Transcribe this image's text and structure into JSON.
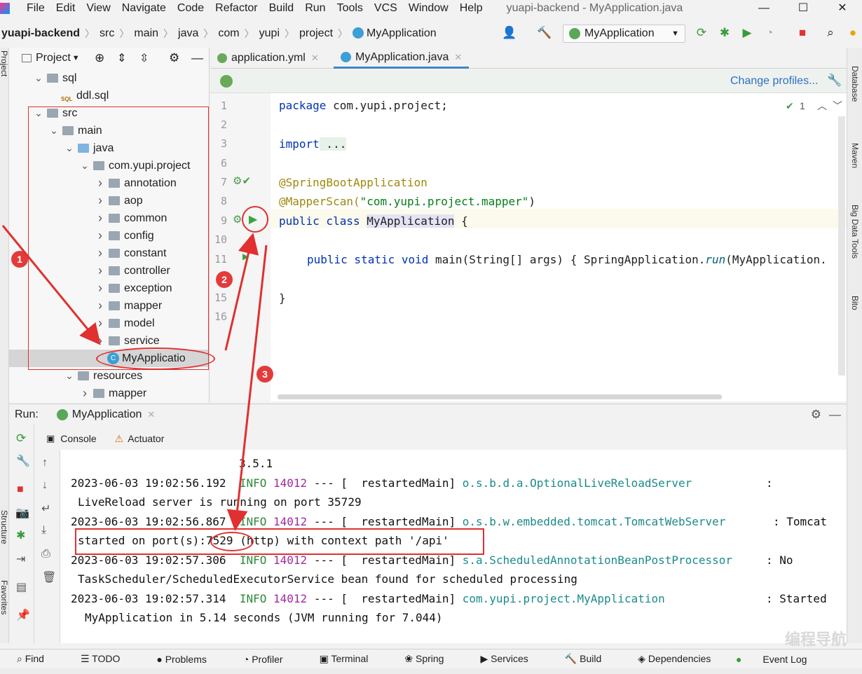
{
  "menubar": {
    "items": [
      "File",
      "Edit",
      "View",
      "Navigate",
      "Code",
      "Refactor",
      "Build",
      "Run",
      "Tools",
      "VCS",
      "Window",
      "Help"
    ],
    "window_title": "yuapi-backend - MyApplication.java",
    "win_min": "—",
    "win_max": "☐",
    "win_close": "✕"
  },
  "breadcrumb": [
    "yuapi-backend",
    "src",
    "main",
    "java",
    "com",
    "yupi",
    "project",
    "MyApplication"
  ],
  "run_config": {
    "label": "MyApplication"
  },
  "project": {
    "title": "Project",
    "tree": [
      {
        "label": "sql",
        "depth": 1,
        "kind": "folder",
        "expanded": true
      },
      {
        "label": "ddl.sql",
        "depth": 2,
        "kind": "sql"
      },
      {
        "label": "src",
        "depth": 1,
        "kind": "folder",
        "expanded": true
      },
      {
        "label": "main",
        "depth": 2,
        "kind": "folder",
        "expanded": true
      },
      {
        "label": "java",
        "depth": 3,
        "kind": "folder-blue",
        "expanded": true
      },
      {
        "label": "com.yupi.project",
        "depth": 4,
        "kind": "folder",
        "expanded": true
      },
      {
        "label": "annotation",
        "depth": 5,
        "kind": "folder",
        "expanded": false
      },
      {
        "label": "aop",
        "depth": 5,
        "kind": "folder",
        "expanded": false
      },
      {
        "label": "common",
        "depth": 5,
        "kind": "folder",
        "expanded": false
      },
      {
        "label": "config",
        "depth": 5,
        "kind": "folder",
        "expanded": false
      },
      {
        "label": "constant",
        "depth": 5,
        "kind": "folder",
        "expanded": false
      },
      {
        "label": "controller",
        "depth": 5,
        "kind": "folder",
        "expanded": false
      },
      {
        "label": "exception",
        "depth": 5,
        "kind": "folder",
        "expanded": false
      },
      {
        "label": "mapper",
        "depth": 5,
        "kind": "folder",
        "expanded": false
      },
      {
        "label": "model",
        "depth": 5,
        "kind": "folder",
        "expanded": false
      },
      {
        "label": "service",
        "depth": 5,
        "kind": "folder",
        "expanded": false
      },
      {
        "label": "MyApplicatio",
        "depth": 5,
        "kind": "class",
        "selected": true
      },
      {
        "label": "resources",
        "depth": 3,
        "kind": "folder",
        "expanded": true
      },
      {
        "label": "mapper",
        "depth": 4,
        "kind": "folder",
        "expanded": false
      }
    ]
  },
  "editor": {
    "tabs": [
      {
        "label": "application.yml",
        "active": false
      },
      {
        "label": "MyApplication.java",
        "active": true
      }
    ],
    "change_profiles": "Change profiles...",
    "inspection_count": "1",
    "line_numbers": [
      "1",
      "2",
      "3",
      "6",
      "7",
      "8",
      "9",
      "10",
      "11",
      "15",
      "16"
    ],
    "code": {
      "l1_kw": "package",
      "l1_rest": " com.yupi.project;",
      "l3_kw": "import",
      "l3_rest": " ...",
      "l7": "@SpringBootApplication",
      "l8_ann": "@MapperScan(",
      "l8_str": "\"com.yupi.project.mapper\"",
      "l8_end": ")",
      "l9_kw": "public class ",
      "l9_name": "MyApplication",
      "l9_end": " {",
      "l11_kw": "public static void ",
      "l11_mid": "main(String[] args) { SpringApplication.",
      "l11_it": "run",
      "l11_end": "(MyApplication.",
      "l15": "}"
    }
  },
  "run": {
    "label": "Run:",
    "tab": "MyApplication",
    "sub_console": "Console",
    "sub_actuator": "Actuator",
    "lines": {
      "v": "3.5.1",
      "t1": "2023-06-03 19:02:56.192",
      "t2": "2023-06-03 19:02:56.867",
      "t3": "2023-06-03 19:02:57.306",
      "t4": "2023-06-03 19:02:57.314",
      "info": "INFO",
      "pid": "14012",
      "dash": "--- [  restartedMain]",
      "lg1": "o.s.b.d.a.OptionalLiveReloadServer",
      "lg2": "o.s.b.w.embedded.tomcat.TomcatWebServer",
      "lg3": "s.a.ScheduledAnnotationBeanPostProcessor",
      "lg4": "com.yupi.project.MyApplication",
      "m1a": ":",
      "m1b": "LiveReload server is running on port 35729",
      "m2a": ": Tomcat",
      "m2b_pre": "started on port(s):",
      "m2b_port": "7529",
      "m2b_post": " (http) with context path '/api'",
      "m3a": ": No",
      "m3b": "TaskScheduler/ScheduledExecutorService bean found for scheduled processing",
      "m4a": ": Started",
      "m4b": "MyApplication in 5.14 seconds (JVM running for 7.044)"
    }
  },
  "bottombar": [
    "Find",
    "TODO",
    "Problems",
    "Profiler",
    "Terminal",
    "Spring",
    "Services",
    "Build",
    "Dependencies"
  ],
  "bottom_right": "Event Log",
  "side_labels": {
    "left_top": "Project",
    "left_mid": "Structure",
    "left_bot": "Favorites",
    "right1": "Database",
    "right2": "Maven",
    "right3": "Big Data Tools",
    "right4": "Bito"
  },
  "badges": [
    "1",
    "2",
    "3"
  ],
  "watermark": "编程导航"
}
